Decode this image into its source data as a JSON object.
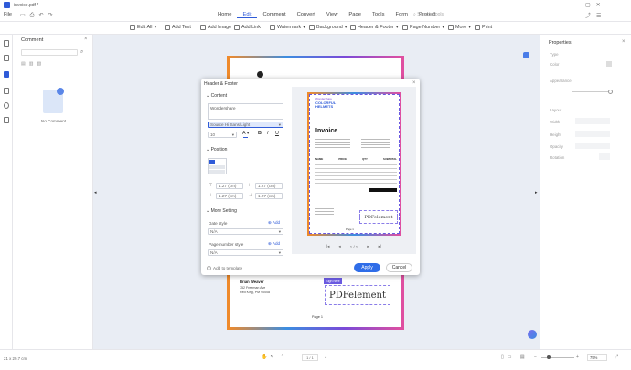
{
  "window": {
    "filename": "invoice.pdf *",
    "file_menu": "File"
  },
  "menu": [
    "Home",
    "Edit",
    "Comment",
    "Convert",
    "View",
    "Page",
    "Tools",
    "Form",
    "Protect"
  ],
  "search_tools": "Search Tools",
  "toolbar": {
    "edit_all": "Edit All",
    "add_text": "Add Text",
    "add_image": "Add Image",
    "add_link": "Add Link",
    "watermark": "Watermark",
    "background": "Background",
    "header_footer": "Header & Footer",
    "page_number": "Page Number",
    "more": "More",
    "print": "Print"
  },
  "comment_panel": {
    "title": "Comment",
    "empty_text": "No Comment"
  },
  "properties": {
    "title": "Properties",
    "fields": [
      "Type",
      "Color",
      "Appearance",
      "Layout",
      "Width",
      "Height",
      "Opacity",
      "Rotation"
    ]
  },
  "dialog": {
    "title": "Header & Footer",
    "content_label": "Content",
    "content_value": "Wondershare",
    "font_value": "Source Hi Sans/Light",
    "size_value": "10",
    "position_label": "Position",
    "margins": [
      "1.27 (cm)",
      "1.27 (cm)",
      "1.27 (cm)",
      "1.27 (cm)"
    ],
    "more_setting_label": "More Setting",
    "date_style_label": "Date style",
    "date_style_value": "N/A",
    "page_number_style_label": "Page number style",
    "page_number_style_value": "N/A",
    "add_label": "Add",
    "apply_to_template": "Add to template",
    "apply_button": "Apply",
    "cancel_button": "Cancel",
    "pager": "1 / 1"
  },
  "preview": {
    "brand_small": "Wondershare",
    "brand": "COLORFUL HELMETS",
    "invoice_title": "Invoice",
    "columns": [
      "NAME",
      "PRICE",
      "QTY",
      "SUBTOTAL"
    ],
    "signature": "PDFelement",
    "page_label": "Page 1"
  },
  "document": {
    "signer_label": "Sign here",
    "signature": "PDFelement",
    "signer_name": "Brian Weaver",
    "address1": "752 Freeman Ave",
    "address2": "Red King, PM 90008",
    "page_label": "Page 1"
  },
  "status": {
    "dimensions": "21 x 29.7 cm",
    "page": "1 / 1",
    "zoom": "75%"
  },
  "colors": {
    "accent": "#2f5bd8",
    "canvas": "#e9edf4"
  }
}
